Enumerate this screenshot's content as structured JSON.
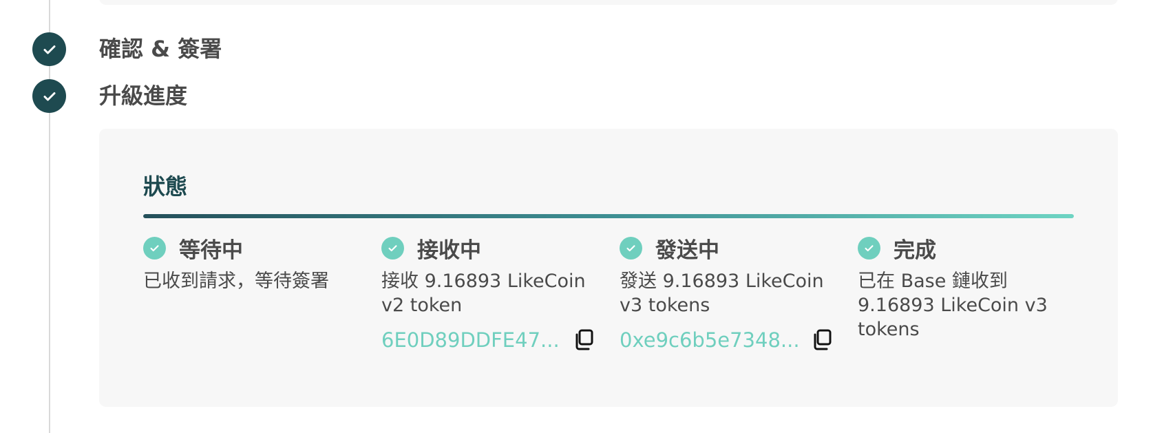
{
  "steps": [
    {
      "title": "確認 & 簽署"
    },
    {
      "title": "升級進度"
    }
  ],
  "status": {
    "heading": "狀態",
    "progress_fraction": 1.0,
    "colors": {
      "accent": "#6fcfbe",
      "dark": "#1e4a50"
    },
    "stages": [
      {
        "title": "等待中",
        "description": "已收到請求，等待簽署"
      },
      {
        "title": "接收中",
        "description": "接收 9.16893 LikeCoin v2 token",
        "hash": "6E0D89DDFE47..."
      },
      {
        "title": "發送中",
        "description": "發送 9.16893 LikeCoin v3 tokens",
        "hash": "0xe9c6b5e7348..."
      },
      {
        "title": "完成",
        "description": "已在 Base 鏈收到 9.16893 LikeCoin v3 tokens"
      }
    ]
  }
}
